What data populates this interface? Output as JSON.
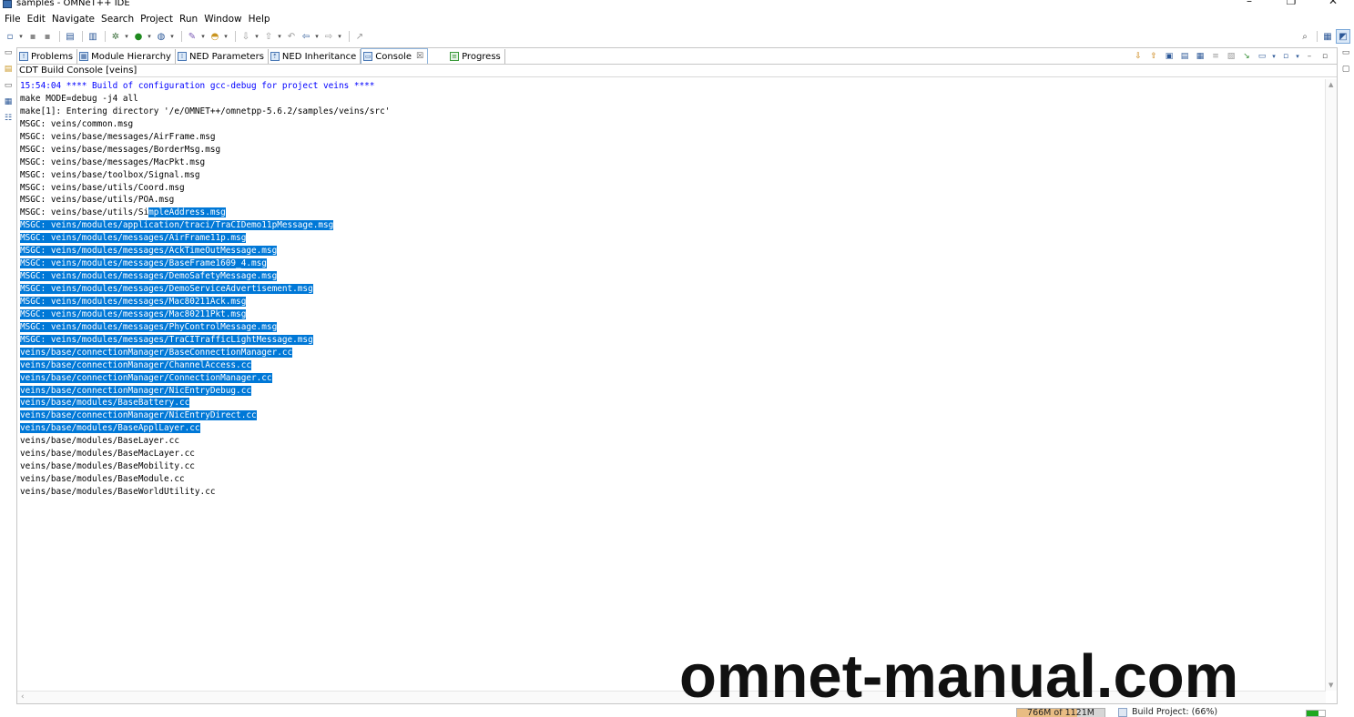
{
  "window": {
    "title": "samples - OMNeT++ IDE",
    "controls": {
      "minimize": "–",
      "maximize": "❐",
      "close": "✕"
    }
  },
  "menu": [
    "File",
    "Edit",
    "Navigate",
    "Search",
    "Project",
    "Run",
    "Window",
    "Help"
  ],
  "tabs": [
    {
      "label": "Problems",
      "icon": "problems-icon"
    },
    {
      "label": "Module Hierarchy",
      "icon": "module-hierarchy-icon"
    },
    {
      "label": "NED Parameters",
      "icon": "ned-parameters-icon"
    },
    {
      "label": "NED Inheritance",
      "icon": "ned-inheritance-icon"
    },
    {
      "label": "Console",
      "icon": "console-icon",
      "active": true,
      "close": "☒"
    },
    {
      "label": "Progress",
      "icon": "progress-icon"
    }
  ],
  "console": {
    "name": "CDT Build Console [veins]",
    "lines": [
      {
        "text": "15:54:04 **** Build of configuration gcc-debug for project veins ****",
        "kind": "cmd"
      },
      {
        "text": "make MODE=debug -j4 all"
      },
      {
        "text": "make[1]: Entering directory '/e/OMNET++/omnetpp-5.6.2/samples/veins/src'"
      },
      {
        "text": "MSGC: veins/common.msg"
      },
      {
        "text": "MSGC: veins/base/messages/AirFrame.msg"
      },
      {
        "text": "MSGC: veins/base/messages/BorderMsg.msg"
      },
      {
        "text": "MSGC: veins/base/messages/MacPkt.msg"
      },
      {
        "text": "MSGC: veins/base/toolbox/Signal.msg"
      },
      {
        "text": "MSGC: veins/base/utils/Coord.msg"
      },
      {
        "text": "MSGC: veins/base/utils/POA.msg"
      },
      {
        "pre": "MSGC: veins/base/utils/Si",
        "sel": "mpleAddress.msg"
      },
      {
        "sel": "MSGC: veins/modules/application/traci/TraCIDemo11pMessage.msg"
      },
      {
        "sel": "MSGC: veins/modules/messages/AirFrame11p.msg"
      },
      {
        "sel": "MSGC: veins/modules/messages/AckTimeOutMessage.msg"
      },
      {
        "sel": "MSGC: veins/modules/messages/BaseFrame1609_4.msg"
      },
      {
        "sel": "MSGC: veins/modules/messages/DemoSafetyMessage.msg"
      },
      {
        "sel": "MSGC: veins/modules/messages/DemoServiceAdvertisement.msg"
      },
      {
        "sel": "MSGC: veins/modules/messages/Mac80211Ack.msg"
      },
      {
        "sel": "MSGC: veins/modules/messages/Mac80211Pkt.msg"
      },
      {
        "sel": "MSGC: veins/modules/messages/PhyControlMessage.msg"
      },
      {
        "sel": "MSGC: veins/modules/messages/TraCITrafficLightMessage.msg"
      },
      {
        "sel": "veins/base/connectionManager/BaseConnectionManager.cc"
      },
      {
        "sel": "veins/base/connectionManager/ChannelAccess.cc"
      },
      {
        "sel": "veins/base/connectionManager/ConnectionManager.cc"
      },
      {
        "sel": "veins/base/connectionManager/NicEntryDebug.cc"
      },
      {
        "sel": "veins/base/modules/BaseBattery.cc"
      },
      {
        "sel": "veins/base/connectionManager/NicEntryDirect.cc"
      },
      {
        "sel": "veins/base/modules/BaseApplLayer.cc"
      },
      {
        "text": "veins/base/modules/BaseLayer.cc"
      },
      {
        "text": "veins/base/modules/BaseMacLayer.cc"
      },
      {
        "text": "veins/base/modules/BaseMobility.cc"
      },
      {
        "text": "veins/base/modules/BaseModule.cc"
      },
      {
        "text": "veins/base/modules/BaseWorldUtility.cc"
      }
    ]
  },
  "status": {
    "heap": "766M of 1121M",
    "heap_used_fraction": 0.683,
    "build": "Build Project: (66%)",
    "build_progress_fraction": 0.66
  },
  "watermark": "omnet-manual.com",
  "colors": {
    "selection": "#0078d7",
    "command_text": "#0000ff",
    "build_progress": "#1fa81f"
  }
}
